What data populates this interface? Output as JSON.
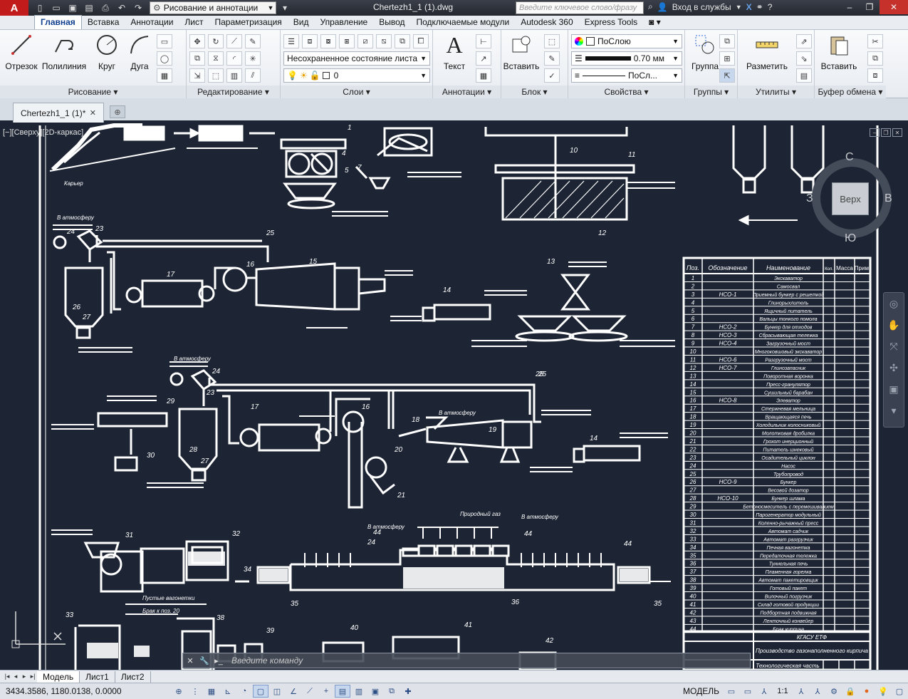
{
  "titlebar": {
    "workspace": "Рисование и аннотации",
    "document_title": "Chertezh1_1 (1).dwg",
    "search_placeholder": "Введите ключевое слово/фразу",
    "signin": "Вход в службы"
  },
  "ribbon_tabs": [
    "Главная",
    "Вставка",
    "Аннотации",
    "Лист",
    "Параметризация",
    "Вид",
    "Управление",
    "Вывод",
    "Подключаемые модули",
    "Autodesk 360",
    "Express Tools"
  ],
  "ribbon": {
    "draw": {
      "title": "Рисование",
      "line": "Отрезок",
      "polyline": "Полилиния",
      "circle": "Круг",
      "arc": "Дуга"
    },
    "modify": {
      "title": "Редактирование"
    },
    "layers": {
      "title": "Слои",
      "layer_state": "Несохраненное состояние листа",
      "current_layer": "0"
    },
    "annotation": {
      "title": "Аннотации",
      "text": "Текст"
    },
    "block": {
      "title": "Блок",
      "insert": "Вставить"
    },
    "properties": {
      "title": "Свойства",
      "color": "ПоСлою",
      "lineweight": "0.70 мм",
      "linetype": "ПоСл..."
    },
    "groups": {
      "title": "Группы",
      "group": "Группа"
    },
    "utilities": {
      "title": "Утилиты",
      "measure": "Разметить"
    },
    "clipboard": {
      "title": "Буфер обмена",
      "paste": "Вставить"
    }
  },
  "file_tab": {
    "name": "Chertezh1_1 (1)*"
  },
  "viewport": {
    "label": "[−][Сверху][2D-каркас]",
    "viewcube": {
      "top": "Верх",
      "north": "С",
      "south": "Ю",
      "east": "В",
      "west": "З"
    },
    "command_placeholder": "Введите команду"
  },
  "drawing": {
    "quarry_label": "Карьер",
    "to_atmosphere": "В атмосферу",
    "natural_gas": "Природный газ",
    "empty_carts": "Пустые вагонетки",
    "defect_label": "Брак к поз. 20",
    "spec_headers": [
      "Поз.",
      "Обозначение",
      "Наименование",
      "Кол.",
      "Масса",
      "Прим."
    ],
    "spec_rows": [
      [
        "1",
        "",
        "Экскаватор"
      ],
      [
        "2",
        "",
        "Самосвал"
      ],
      [
        "3",
        "НСО-1",
        "Приемный бункер с решеткой"
      ],
      [
        "4",
        "",
        "Глинорыхлитель"
      ],
      [
        "5",
        "",
        "Ящичный питатель"
      ],
      [
        "6",
        "",
        "Вальцы тонкого помола"
      ],
      [
        "7",
        "НСО-2",
        "Бункер для отходов"
      ],
      [
        "8",
        "НСО-3",
        "Сбрасывающая тележка"
      ],
      [
        "9",
        "НСО-4",
        "Загрузочный мост"
      ],
      [
        "10",
        "",
        "Многоковшовый экскаватор"
      ],
      [
        "11",
        "НСО-6",
        "Разгрузочный мост"
      ],
      [
        "12",
        "НСО-7",
        "Глинозапасник"
      ],
      [
        "13",
        "",
        "Поворотная воронка"
      ],
      [
        "14",
        "",
        "Пресс-гранулятор"
      ],
      [
        "15",
        "",
        "Сушильный барабан"
      ],
      [
        "16",
        "НСО-8",
        "Элеватор"
      ],
      [
        "17",
        "",
        "Стержневая мельница"
      ],
      [
        "18",
        "",
        "Вращающаяся печь"
      ],
      [
        "19",
        "",
        "Холодильник колосниковый"
      ],
      [
        "20",
        "",
        "Молотковая дробилка"
      ],
      [
        "21",
        "",
        "Грохот инерционный"
      ],
      [
        "22",
        "",
        "Питатель шнековый"
      ],
      [
        "23",
        "",
        "Осадительный циклон"
      ],
      [
        "24",
        "",
        "Насос"
      ],
      [
        "25",
        "",
        "Трубопровод"
      ],
      [
        "26",
        "НСО-9",
        "Бункер"
      ],
      [
        "27",
        "",
        "Весовой дозатор"
      ],
      [
        "28",
        "НСО-10",
        "Бункер шлама"
      ],
      [
        "29",
        "",
        "Бетоносмеситель с перемешиванием"
      ],
      [
        "30",
        "",
        "Парогенератор модульный"
      ],
      [
        "31",
        "",
        "Коленно-рычажный пресс"
      ],
      [
        "32",
        "",
        "Автомат садчик"
      ],
      [
        "33",
        "",
        "Автомат разгрузчик"
      ],
      [
        "34",
        "",
        "Печная вагонетка"
      ],
      [
        "35",
        "",
        "Передаточная тележка"
      ],
      [
        "36",
        "",
        "Туннельная печь"
      ],
      [
        "37",
        "",
        "Пламенная горелка"
      ],
      [
        "38",
        "",
        "Автомат пакетировщик"
      ],
      [
        "39",
        "",
        "Готовый пакет"
      ],
      [
        "40",
        "",
        "Вилочный погрузчик"
      ],
      [
        "41",
        "",
        "Склад готовой продукции"
      ],
      [
        "42",
        "",
        "Подбортная подвижная"
      ],
      [
        "43",
        "",
        "Ленточный конвейер"
      ],
      [
        "44",
        "",
        "Брак кирпича"
      ]
    ],
    "stamp_org": "КГАСУ ЕТФ",
    "stamp_title": "Производство газонаполненного кирпича",
    "stamp_part": "Технологическая часть"
  },
  "layout_tabs": [
    "Модель",
    "Лист1",
    "Лист2"
  ],
  "statusbar": {
    "coords": "3434.3586, 1180.0138, 0.0000",
    "mode": "МОДЕЛЬ",
    "scale": "1:1"
  }
}
